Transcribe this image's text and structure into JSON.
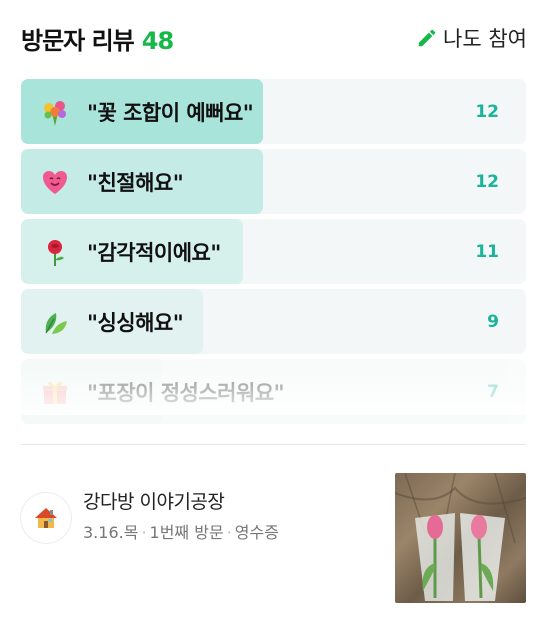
{
  "header": {
    "title": "방문자 리뷰",
    "count": "48",
    "join_label": "나도 참여"
  },
  "reviews": [
    {
      "emoji": "flower-bouquet-icon",
      "label": "\"꽃 조합이 예뻐요\"",
      "count": "12",
      "fill": 0.48,
      "fill_color": "#a9e4da"
    },
    {
      "emoji": "heart-face-icon",
      "label": "\"친절해요\"",
      "count": "12",
      "fill": 0.48,
      "fill_color": "#c4ebe6"
    },
    {
      "emoji": "rose-icon",
      "label": "\"감각적이에요\"",
      "count": "11",
      "fill": 0.44,
      "fill_color": "#d6f0ec"
    },
    {
      "emoji": "leaf-icon",
      "label": "\"싱싱해요\"",
      "count": "9",
      "fill": 0.36,
      "fill_color": "#e2f2f0"
    },
    {
      "emoji": "gift-icon",
      "label": "\"포장이 정성스러워요\"",
      "count": "7",
      "fill": 0.28,
      "fill_color": "#e9f4f2"
    }
  ],
  "author": {
    "name": "강다방 이야기공장",
    "date": "3.16.목",
    "visit": "1번째 방문",
    "verify": "영수증"
  },
  "colors": {
    "accent_green": "#18b74a",
    "count_teal": "#1bb39a"
  }
}
